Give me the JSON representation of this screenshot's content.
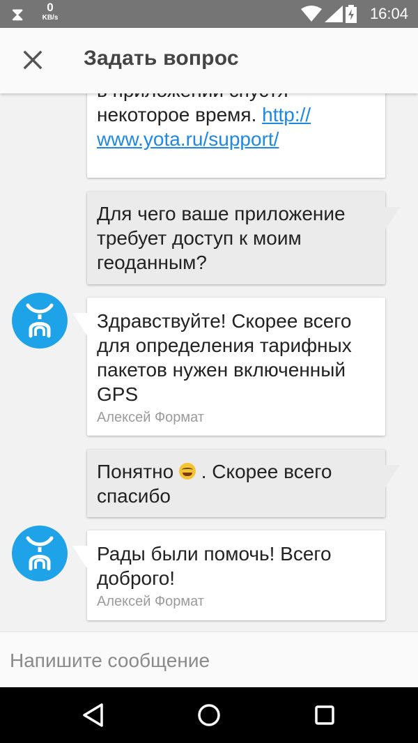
{
  "status_bar": {
    "net_speed_value": "0",
    "net_speed_unit": "KB/s",
    "time": "16:04"
  },
  "app_bar": {
    "title": "Задать вопрос",
    "close_icon": "close-icon"
  },
  "messages": [
    {
      "type": "incoming",
      "text_partial_top": "в приложении спустя",
      "text": "некоторое время. ",
      "link": "http://www.yota.ru/support/",
      "link_line1": "http://",
      "link_line2": "www.yota.ru/support/"
    },
    {
      "type": "outgoing",
      "lines": [
        "Для чего ваше приложение",
        "требует доступ к моим",
        "геоданным?"
      ]
    },
    {
      "type": "incoming",
      "lines": [
        "Здравствуйте! Скорее всего",
        "для определения тарифных",
        "пакетов нужен включенный",
        "GPS"
      ],
      "author": "Алексей Формат",
      "avatar_icon": "yota-logo-icon"
    },
    {
      "type": "outgoing",
      "line1_before": "Понятно ",
      "emoji": "laughing-tears-emoji-icon",
      "line1_after": " . Скорее всего",
      "line2": "спасибо"
    },
    {
      "type": "incoming",
      "lines": [
        "Рады были помочь! Всего",
        "доброго!"
      ],
      "author": "Алексей Формат",
      "avatar_icon": "yota-logo-icon"
    }
  ],
  "composer": {
    "placeholder": "Напишите сообщение",
    "value": ""
  },
  "nav_bar": {
    "back_icon": "back-triangle-icon",
    "home_icon": "home-circle-icon",
    "recents_icon": "recents-square-icon"
  },
  "colors": {
    "status_bar": "#757575",
    "yota_blue": "#1fa3e8",
    "link": "#1e88e5",
    "outgoing_bubble": "#ebebeb",
    "incoming_bubble": "#ffffff",
    "background": "#f2f2f2"
  }
}
